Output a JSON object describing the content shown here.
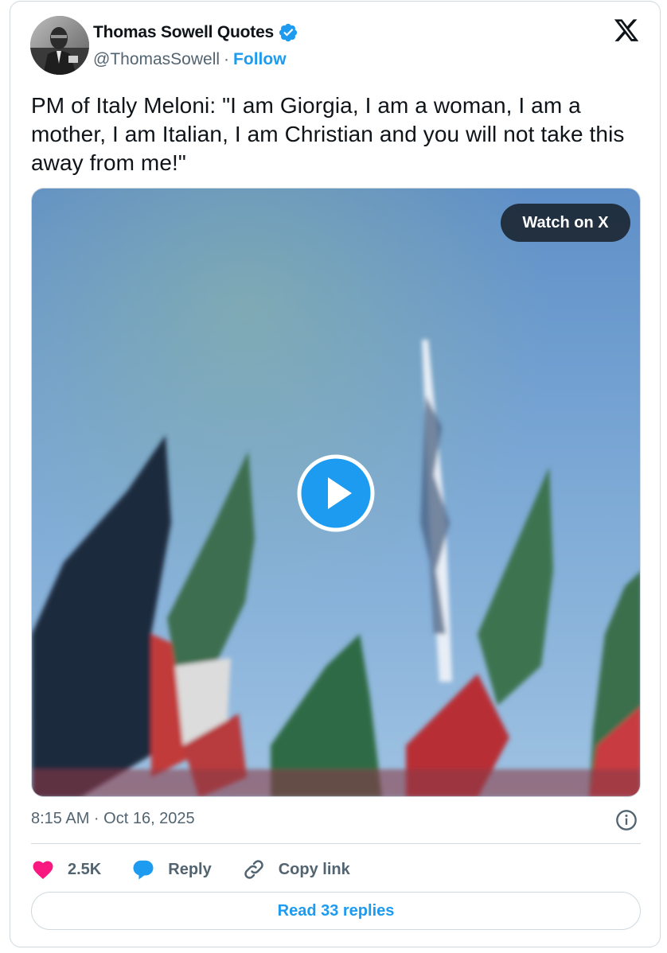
{
  "author": {
    "name": "Thomas Sowell Quotes",
    "handle": "@ThomasSowell",
    "separator": "·",
    "follow_label": "Follow",
    "verified": true
  },
  "tweet": {
    "text": "PM of Italy Meloni: \"I am Giorgia, I am a woman, I am a mother, I am Italian, I am Christian and you will not take this away from me!\""
  },
  "media": {
    "type": "video",
    "watch_label": "Watch on X"
  },
  "meta": {
    "timestamp": "8:15 AM · Oct 16, 2025"
  },
  "actions": {
    "like_count": "2.5K",
    "reply_label": "Reply",
    "copy_link_label": "Copy link"
  },
  "read_replies_label": "Read 33 replies",
  "colors": {
    "accent": "#1d9bf0",
    "like": "#f91880",
    "secondary_text": "#536471",
    "border": "#cfd9de"
  },
  "icons": {
    "verified": "verified-badge-icon",
    "brand": "x-logo-icon",
    "play": "play-icon",
    "info": "info-icon",
    "like": "heart-icon",
    "reply": "speech-bubble-icon",
    "copy": "link-icon"
  }
}
